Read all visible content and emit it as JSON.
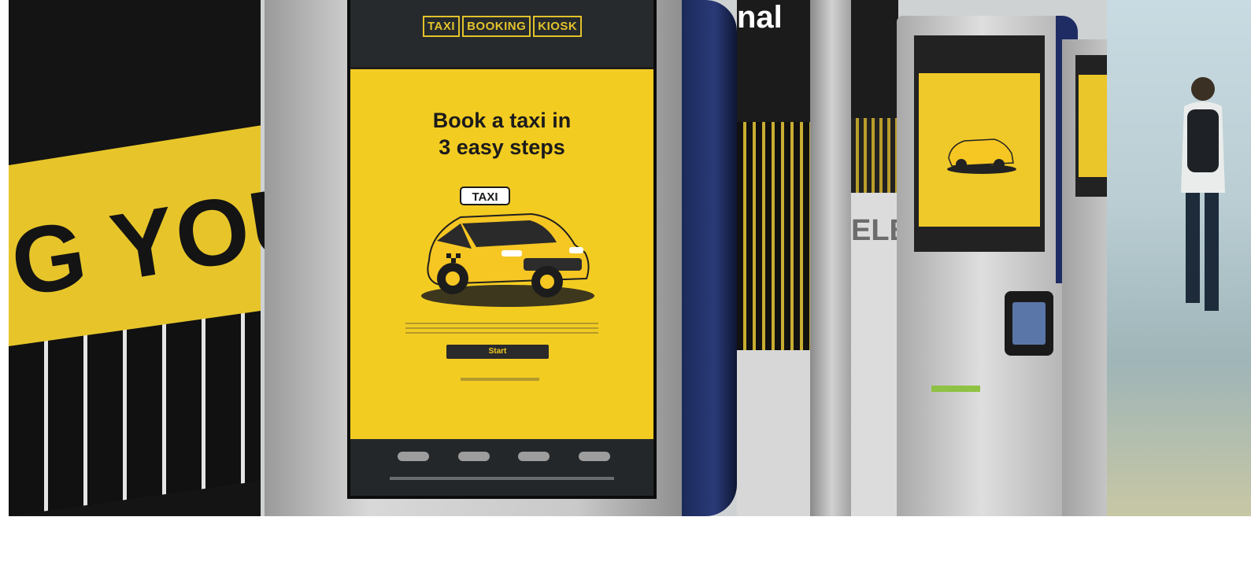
{
  "photo": {
    "wall_text": "G YOU",
    "kiosk_screen": {
      "brand_words": [
        "TAXI",
        "BOOKING",
        "KIOSK"
      ],
      "headline": "Book a taxi in\n3 easy steps",
      "taxi_roof_sign": "TAXI",
      "start_button": "Start"
    },
    "side_sign_fragment": "nal",
    "wall_fragment_text": "ELBOU"
  },
  "colors": {
    "kiosk_yellow": "#f3cc22",
    "wall_yellow": "#e7c52a",
    "kiosk_blue": "#2a3a78"
  }
}
